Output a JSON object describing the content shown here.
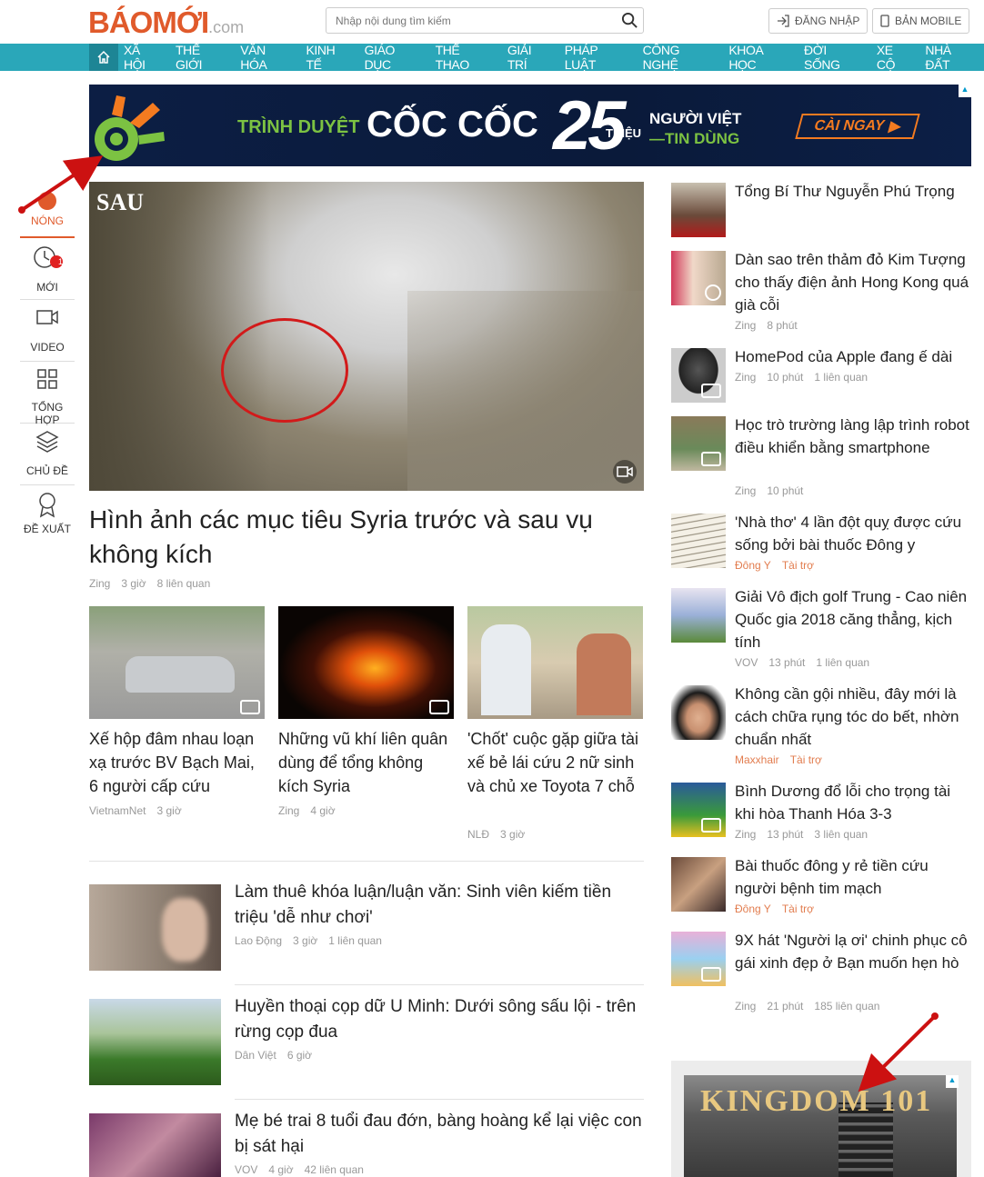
{
  "header": {
    "logo_main": "BÁOMỚI",
    "logo_suffix": ".com",
    "search_placeholder": "Nhập nội dung tìm kiếm",
    "login": "ĐĂNG NHẬP",
    "mobile": "BẢN MOBILE"
  },
  "nav": {
    "items": [
      "XÃ HỘI",
      "THẾ GIỚI",
      "VĂN HÓA",
      "KINH TẾ",
      "GIÁO DỤC",
      "THỂ THAO",
      "GIẢI TRÍ",
      "PHÁP LUẬT",
      "CÔNG NGHỆ",
      "KHOA HỌC",
      "ĐỜI SỐNG",
      "XE CỘ",
      "NHÀ ĐẤT"
    ]
  },
  "banner": {
    "text1": "TRÌNH DUYỆT",
    "text2": "CỐC CỐC",
    "number": "25",
    "unit": "TRIỆU",
    "line1": "NGƯỜI VIỆT",
    "line2": "TIN DÙNG",
    "cta": "CÀI NGAY"
  },
  "sidebar": {
    "items": [
      "NÓNG",
      "MỚI",
      "VIDEO",
      "TỔNG HỢP",
      "CHỦ ĐỀ",
      "ĐỀ XUẤT"
    ],
    "new_count": "12"
  },
  "hero": {
    "img_label": "SAU",
    "title": "Hình ảnh các mục tiêu Syria trước và sau vụ không kích",
    "source": "Zing",
    "time": "3 giờ",
    "related": "8 liên quan"
  },
  "cards": [
    {
      "title": "Xế hộp đâm nhau loạn xạ trước BV Bạch Mai, 6 người cấp cứu",
      "source": "VietnamNet",
      "time": "3 giờ"
    },
    {
      "title": "Những vũ khí liên quân dùng để tổng không kích Syria",
      "source": "Zing",
      "time": "4 giờ"
    },
    {
      "title": "'Chốt' cuộc gặp giữa tài xế bẻ lái cứu 2 nữ sinh và chủ xe Toyota 7 chỗ",
      "source": "NLĐ",
      "time": "3 giờ"
    }
  ],
  "list": [
    {
      "title": "Làm thuê khóa luận/luận văn: Sinh viên kiếm tiền triệu 'dễ như chơi'",
      "source": "Lao Động",
      "time": "3 giờ",
      "related": "1 liên quan"
    },
    {
      "title": "Huyền thoại cọp dữ U Minh: Dưới sông sấu lội - trên rừng cọp đua",
      "source": "Dân Việt",
      "time": "6 giờ",
      "related": ""
    },
    {
      "title": "Mẹ bé trai 8 tuổi đau đớn, bàng hoàng kể lại việc con bị sát hại",
      "source": "VOV",
      "time": "4 giờ",
      "related": "42 liên quan"
    }
  ],
  "right": [
    {
      "title": "Tổng Bí Thư Nguyễn Phú Trọng",
      "source": "",
      "time": "",
      "related": ""
    },
    {
      "title": "Dàn sao trên thảm đỏ Kim Tượng cho thấy điện ảnh Hong Kong quá già cỗi",
      "source": "Zing",
      "time": "8 phút",
      "related": ""
    },
    {
      "title": "HomePod của Apple đang ế dài",
      "source": "Zing",
      "time": "10 phút",
      "related": "1 liên quan"
    },
    {
      "title": "Học trò trường làng lập trình robot điều khiển bằng smartphone",
      "source": "Zing",
      "time": "10 phút",
      "related": ""
    },
    {
      "title": "'Nhà thơ' 4 lần đột quỵ được cứu sống bởi bài thuốc Đông y",
      "source": "Đông Y",
      "time": "Tài trợ",
      "related": ""
    },
    {
      "title": "Giải Vô địch golf Trung - Cao niên Quốc gia 2018 căng thẳng, kịch tính",
      "source": "VOV",
      "time": "13 phút",
      "related": "1 liên quan"
    },
    {
      "title": "Không cần gội nhiều, đây mới là cách chữa rụng tóc do bết, nhờn chuẩn nhất",
      "source": "Maxxhair",
      "time": "Tài trợ",
      "related": ""
    },
    {
      "title": "Bình Dương đổ lỗi cho trọng tài khi hòa Thanh Hóa 3-3",
      "source": "Zing",
      "time": "13 phút",
      "related": "3 liên quan"
    },
    {
      "title": "Bài thuốc đông y rẻ tiền cứu người bệnh tim mạch",
      "source": "Đông Y",
      "time": "Tài trợ",
      "related": ""
    },
    {
      "title": "9X hát 'Người lạ ơi' chinh phục cô gái xinh đẹp ở Bạn muốn hẹn hò",
      "source": "Zing",
      "time": "21 phút",
      "related": "185 liên quan"
    }
  ],
  "ad2": {
    "text": "KINGDOM 101"
  },
  "colors": {
    "brand": "#e05a2b",
    "nav": "#2aa7b9",
    "arrow": "#cc1111"
  }
}
